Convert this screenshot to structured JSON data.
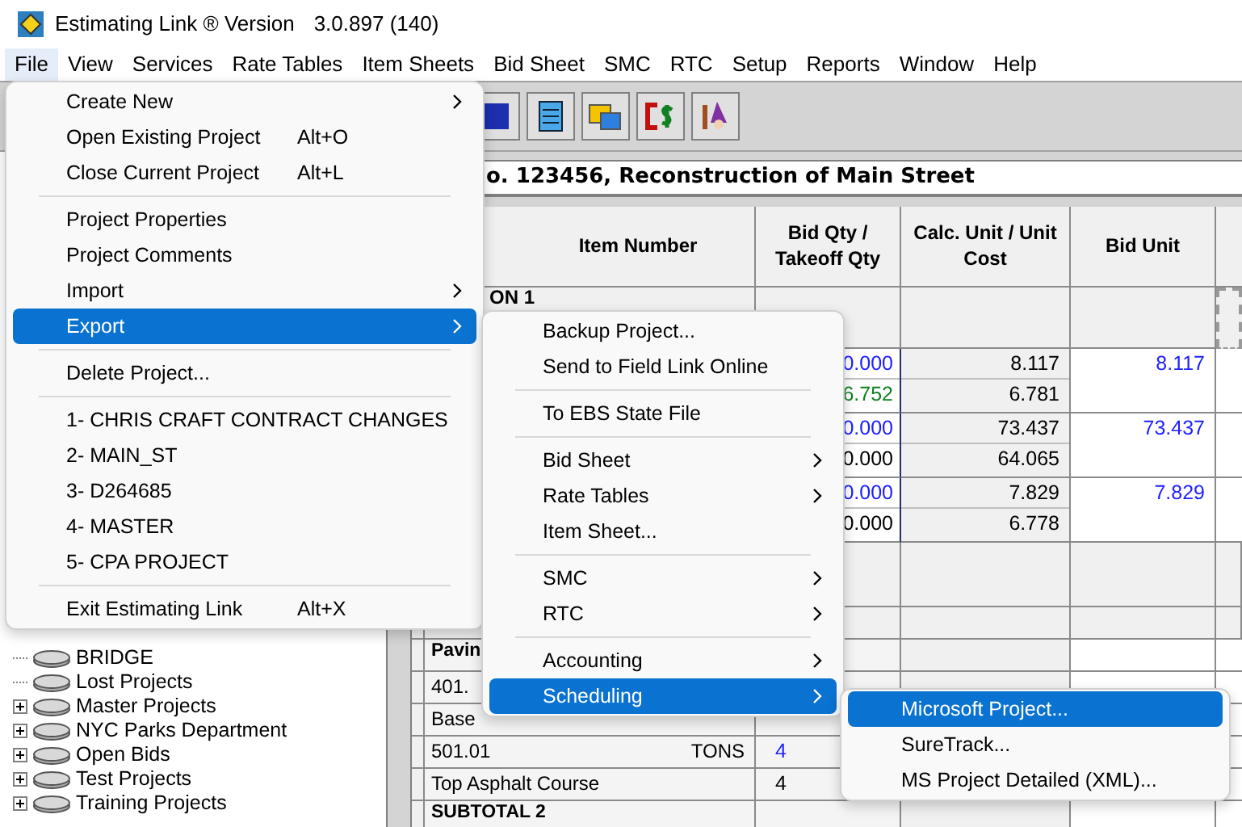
{
  "window": {
    "title": "Estimating Link ® Version",
    "version": "3.0.897 (140)"
  },
  "menu_bar": [
    {
      "label": "File",
      "selected": true
    },
    {
      "label": "View",
      "selected": false
    },
    {
      "label": "Services",
      "selected": false
    },
    {
      "label": "Rate Tables",
      "selected": false
    },
    {
      "label": "Item Sheets",
      "selected": false
    },
    {
      "label": "Bid Sheet",
      "selected": false
    },
    {
      "label": "SMC",
      "selected": false
    },
    {
      "label": "RTC",
      "selected": false
    },
    {
      "label": "Setup",
      "selected": false
    },
    {
      "label": "Reports",
      "selected": false
    },
    {
      "label": "Window",
      "selected": false
    },
    {
      "label": "Help",
      "selected": false
    }
  ],
  "project_title": "o. 123456, Reconstruction of Main Street",
  "grid": {
    "columns": [
      "Item Number",
      "Bid Qty / Takeoff Qty",
      "Calc. Unit / Unit Cost",
      "Bid Unit"
    ],
    "section": "ON 1",
    "items": [
      {
        "bid_qty": "0.000",
        "takeoff_qty": "6.752",
        "takeoff_linked": true,
        "calc_unit": "8.117",
        "unit_cost": "6.781",
        "bid_unit": "8.117"
      },
      {
        "bid_qty": "0.000",
        "takeoff_qty": "0.000",
        "takeoff_linked": false,
        "calc_unit": "73.437",
        "unit_cost": "64.065",
        "bid_unit": "73.437"
      },
      {
        "bid_qty": "0.000",
        "takeoff_qty": "0.000",
        "takeoff_linked": false,
        "calc_unit": "7.829",
        "unit_cost": "6.778",
        "bid_unit": "7.829"
      }
    ],
    "lower_rows": [
      {
        "kind": "heading",
        "text": "Pavin"
      },
      {
        "kind": "number",
        "text": "401."
      },
      {
        "kind": "description",
        "text": "Base"
      },
      {
        "kind": "number",
        "text": "501.01",
        "unit": "TONS",
        "qty": "4"
      },
      {
        "kind": "description",
        "text": "Top Asphalt Course",
        "qty": "4"
      },
      {
        "kind": "heading",
        "text": "SUBTOTAL 2"
      }
    ]
  },
  "tree": [
    {
      "label": "BRIDGE",
      "expandable": false
    },
    {
      "label": "Lost Projects",
      "expandable": false
    },
    {
      "label": "Master Projects",
      "expandable": true
    },
    {
      "label": "NYC Parks Department",
      "expandable": true
    },
    {
      "label": "Open Bids",
      "expandable": true
    },
    {
      "label": "Test Projects",
      "expandable": true
    },
    {
      "label": "Training Projects",
      "expandable": true
    }
  ],
  "file_menu": [
    {
      "kind": "item",
      "label": "Create New",
      "submenu": true,
      "selected": false
    },
    {
      "kind": "item",
      "label": "Open Existing Project",
      "shortcut": "Alt+O",
      "selected": false
    },
    {
      "kind": "item",
      "label": "Close Current Project",
      "shortcut": "Alt+L",
      "selected": false
    },
    {
      "kind": "separator"
    },
    {
      "kind": "item",
      "label": "Project Properties",
      "selected": false
    },
    {
      "kind": "item",
      "label": "Project Comments",
      "selected": false
    },
    {
      "kind": "item",
      "label": "Import",
      "submenu": true,
      "selected": false
    },
    {
      "kind": "item",
      "label": "Export",
      "submenu": true,
      "selected": true
    },
    {
      "kind": "separator"
    },
    {
      "kind": "item",
      "label": "Delete Project...",
      "selected": false
    },
    {
      "kind": "separator"
    },
    {
      "kind": "item",
      "label": "1- CHRIS CRAFT CONTRACT CHANGES",
      "selected": false
    },
    {
      "kind": "item",
      "label": "2- MAIN_ST",
      "selected": false
    },
    {
      "kind": "item",
      "label": "3- D264685",
      "selected": false
    },
    {
      "kind": "item",
      "label": "4- MASTER",
      "selected": false
    },
    {
      "kind": "item",
      "label": "5- CPA PROJECT",
      "selected": false
    },
    {
      "kind": "separator"
    },
    {
      "kind": "item",
      "label": "Exit Estimating Link",
      "shortcut": "Alt+X",
      "selected": false
    }
  ],
  "export_menu": [
    {
      "kind": "item",
      "label": "Backup Project...",
      "selected": false
    },
    {
      "kind": "item",
      "label": "Send to Field Link Online",
      "selected": false
    },
    {
      "kind": "separator"
    },
    {
      "kind": "item",
      "label": "To EBS State File",
      "selected": false
    },
    {
      "kind": "separator"
    },
    {
      "kind": "item",
      "label": "Bid Sheet",
      "submenu": true,
      "selected": false
    },
    {
      "kind": "item",
      "label": "Rate Tables",
      "submenu": true,
      "selected": false
    },
    {
      "kind": "item",
      "label": "Item Sheet...",
      "selected": false
    },
    {
      "kind": "separator"
    },
    {
      "kind": "item",
      "label": "SMC",
      "submenu": true,
      "selected": false
    },
    {
      "kind": "item",
      "label": "RTC",
      "submenu": true,
      "selected": false
    },
    {
      "kind": "separator"
    },
    {
      "kind": "item",
      "label": "Accounting",
      "submenu": true,
      "selected": false
    },
    {
      "kind": "item",
      "label": "Scheduling",
      "submenu": true,
      "selected": true
    }
  ],
  "scheduling_menu": [
    {
      "kind": "item",
      "label": "Microsoft Project...",
      "selected": true
    },
    {
      "kind": "item",
      "label": "SureTrack...",
      "selected": false
    },
    {
      "kind": "item",
      "label": "MS Project Detailed (XML)...",
      "selected": false
    }
  ]
}
